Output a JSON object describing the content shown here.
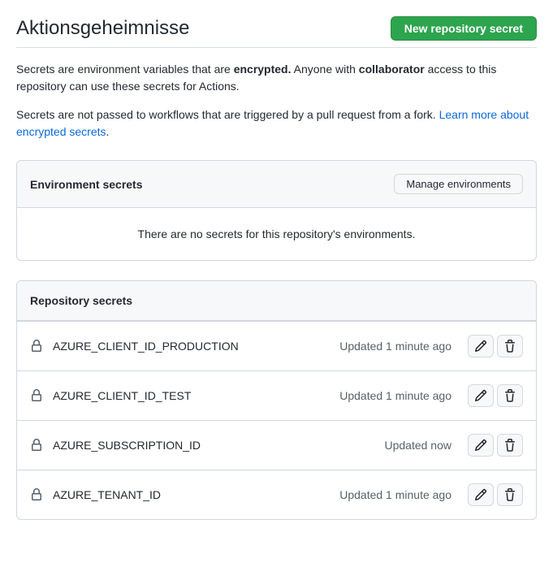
{
  "header": {
    "title": "Aktionsgeheimnisse",
    "new_secret_btn": "New repository secret"
  },
  "intro": {
    "p1_a": "Secrets are environment variables that are ",
    "p1_b": "encrypted.",
    "p1_c": " Anyone with ",
    "p1_d": "collaborator",
    "p1_e": " access to this repository can use these secrets for Actions.",
    "p2_a": "Secrets are not passed to workflows that are triggered by a pull request from a fork. ",
    "p2_link": "Learn more about encrypted secrets",
    "p2_b": "."
  },
  "env": {
    "heading": "Environment secrets",
    "manage_btn": "Manage environments",
    "empty": "There are no secrets for this repository's environments."
  },
  "repo": {
    "heading": "Repository secrets",
    "secrets": [
      {
        "name": "AZURE_CLIENT_ID_PRODUCTION",
        "updated": "Updated 1 minute ago"
      },
      {
        "name": "AZURE_CLIENT_ID_TEST",
        "updated": "Updated 1 minute ago"
      },
      {
        "name": "AZURE_SUBSCRIPTION_ID",
        "updated": "Updated now"
      },
      {
        "name": "AZURE_TENANT_ID",
        "updated": "Updated 1 minute ago"
      }
    ]
  }
}
